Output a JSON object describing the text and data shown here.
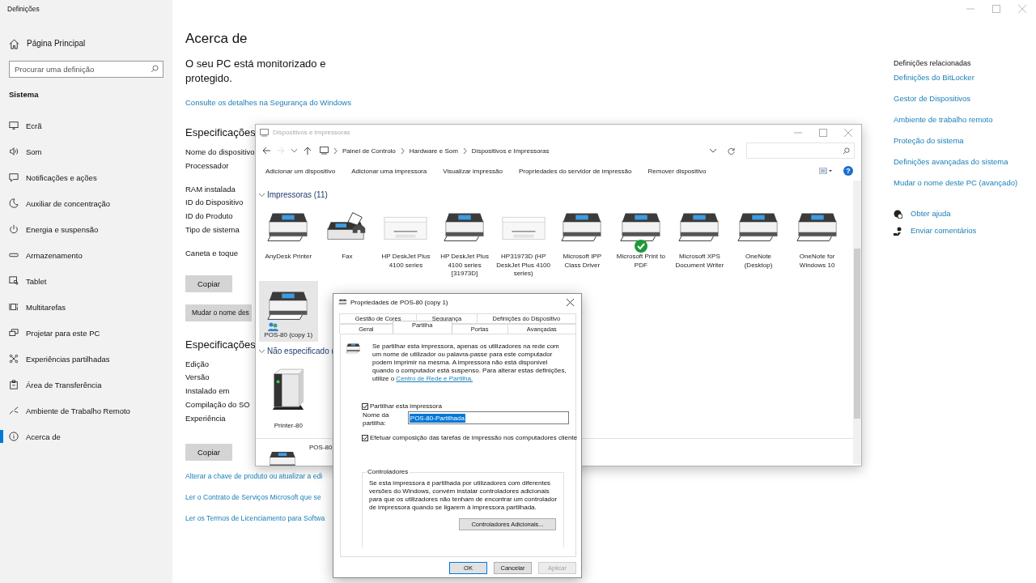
{
  "settings": {
    "window_title": "Definições",
    "home": "Página Principal",
    "search": {
      "placeholder": "Procurar uma definição"
    },
    "section": "Sistema",
    "nav": [
      {
        "label": "Ecrã",
        "selected": false
      },
      {
        "label": "Som",
        "selected": false
      },
      {
        "label": "Notificações e ações",
        "selected": false
      },
      {
        "label": "Auxiliar de concentração",
        "selected": false
      },
      {
        "label": "Energia e suspensão",
        "selected": false
      },
      {
        "label": "Armazenamento",
        "selected": false
      },
      {
        "label": "Tablet",
        "selected": false
      },
      {
        "label": "Multitarefas",
        "selected": false
      },
      {
        "label": "Projetar para este PC",
        "selected": false
      },
      {
        "label": "Experiências partilhadas",
        "selected": false
      },
      {
        "label": "Área de Transferência",
        "selected": false
      },
      {
        "label": "Ambiente de Trabalho Remoto",
        "selected": false
      },
      {
        "label": "Acerca de",
        "selected": true
      }
    ]
  },
  "about": {
    "title": "Acerca de",
    "status": "O seu PC está monitorizado e protegido.",
    "security_link": "Consulte os detalhes na Segurança do Windows",
    "device_specs": {
      "title": "Especificações",
      "labels": [
        "Nome do dispositivo",
        "Processador",
        "RAM instalada",
        "ID do Dispositivo",
        "ID do Produto",
        "Tipo de sistema",
        "Caneta e toque"
      ],
      "copy_button": "Copiar",
      "rename_button": "Mudar o nome des"
    },
    "windows_specs": {
      "title": "Especificações",
      "labels": [
        "Edição",
        "Versão",
        "Instalado em",
        "Compilação do SO",
        "Experiência"
      ],
      "copy_button": "Copiar"
    },
    "links": [
      "Alterar a chave de produto ou atualizar a edi",
      "Ler o Contrato de Serviços Microsoft que se",
      "Ler os Termos de Licenciamento para Softwa"
    ]
  },
  "related": {
    "title": "Definições relacionadas",
    "links": [
      "Definições do BitLocker",
      "Gestor de Dispositivos",
      "Ambiente de trabalho remoto",
      "Proteção do sistema",
      "Definições avançadas do sistema",
      "Mudar o nome deste PC (avançado)"
    ],
    "support": [
      "Obter ajuda",
      "Enviar comentários"
    ]
  },
  "devices_window": {
    "title": "Dispositivos e Impressoras",
    "breadcrumb": [
      "Painel de Controlo",
      "Hardware e Som",
      "Dispositivos e Impressoras"
    ],
    "toolbar": [
      "Adicionar um dispositivo",
      "Adicionar uma impressora",
      "Visualizar impressão",
      "Propriedades do servidor de impressão",
      "Remover dispositivo"
    ],
    "help_button": "?",
    "groups": [
      {
        "title": "Impressoras (11)",
        "expanded": true,
        "devices": [
          {
            "name": "AnyDesk Printer",
            "kind": "printer",
            "default": false,
            "shared": false,
            "selected": false
          },
          {
            "name": "Fax",
            "kind": "fax",
            "default": false,
            "shared": false,
            "selected": false
          },
          {
            "name": "HP DeskJet Plus 4100 series",
            "kind": "inkjet",
            "default": false,
            "shared": false,
            "selected": false
          },
          {
            "name": "HP DeskJet Plus 4100 series [31973D]",
            "kind": "printer",
            "default": false,
            "shared": false,
            "selected": false
          },
          {
            "name": "HP31973D (HP DeskJet Plus 4100 series)",
            "kind": "inkjet",
            "default": false,
            "shared": false,
            "selected": false
          },
          {
            "name": "Microsoft IPP Class Driver",
            "kind": "printer",
            "default": false,
            "shared": false,
            "selected": false
          },
          {
            "name": "Microsoft Print to PDF",
            "kind": "printer",
            "default": true,
            "shared": false,
            "selected": false
          },
          {
            "name": "Microsoft XPS Document Writer",
            "kind": "printer",
            "default": false,
            "shared": false,
            "selected": false
          },
          {
            "name": "OneNote (Desktop)",
            "kind": "printer",
            "default": false,
            "shared": false,
            "selected": false
          },
          {
            "name": "OneNote for Windows 10",
            "kind": "printer",
            "default": false,
            "shared": false,
            "selected": false
          },
          {
            "name": "POS-80 (copy 1)",
            "kind": "printer",
            "default": false,
            "shared": true,
            "selected": true
          }
        ]
      },
      {
        "title": "Não especificado (",
        "expanded": true,
        "devices": [
          {
            "name": "Printer-80",
            "kind": "box",
            "default": false,
            "shared": false,
            "selected": false
          }
        ]
      }
    ],
    "details": {
      "name": "POS-80"
    }
  },
  "dialog": {
    "title": "Propriedades de POS-80 (copy 1)",
    "tab_rows": [
      [
        {
          "label": "Gestão de Cores",
          "selected": false
        },
        {
          "label": "Segurança",
          "selected": false
        },
        {
          "label": "Definições do Dispositivo",
          "selected": false
        }
      ],
      [
        {
          "label": "Geral",
          "selected": false
        },
        {
          "label": "Partilha",
          "selected": true
        },
        {
          "label": "Portas",
          "selected": false
        },
        {
          "label": "Avançadas",
          "selected": false
        }
      ]
    ],
    "intro": "Se partilhar esta impressora, apenas os utilizadores na rede com um nome de utilizador ou palavra-passe para este computador podem imprimir na mesma. A impressora não está disponível quando o computador está suspenso. Para alterar estas definições, utilize o",
    "intro_link": "Centro de Rede e Partilha.",
    "share_checkbox": {
      "label": "Partilhar esta impressora",
      "checked": true
    },
    "share_name": {
      "label": "Nome da partilha:",
      "value": "POS-80-Partilhada"
    },
    "render_checkbox": {
      "label": "Efetuar composição das tarefas de impressão nos computadores cliente",
      "checked": true
    },
    "drivers": {
      "title": "Controladores",
      "text": "Se esta impressora é partilhada por utilizadores com diferentes versões do Windows, convém instalar controladores adicionais para que os utilizadores não tenham de encontrar um controlador de impressora quando se ligarem à impressora partilhada.",
      "button": "Controladores Adicionais..."
    },
    "buttons": [
      {
        "label": "OK",
        "disabled": false
      },
      {
        "label": "Cancelar",
        "disabled": false
      },
      {
        "label": "Aplicar",
        "disabled": true
      }
    ]
  }
}
